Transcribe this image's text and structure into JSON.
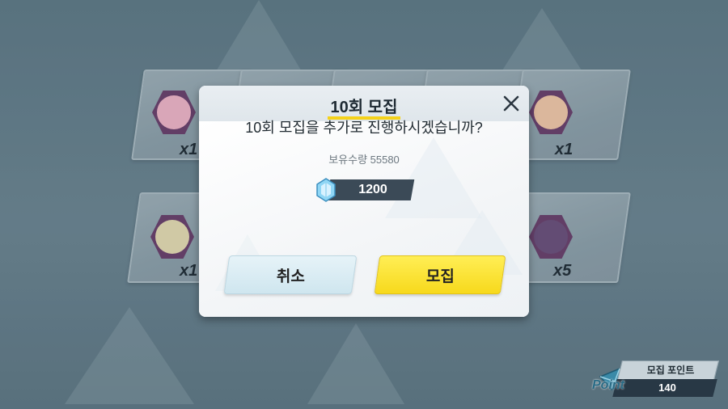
{
  "dialog": {
    "title": "10회 모집",
    "question": "10회 모집을 추가로 진행하시겠습니까?",
    "owned_label": "보유수량 55580",
    "cost": "1200",
    "cancel_label": "취소",
    "confirm_label": "모집"
  },
  "results": [
    {
      "count": "x1",
      "color": "#f2b6c8"
    },
    {
      "count": "x1",
      "color": "#f4c9a8"
    },
    {
      "count": "x1",
      "color": "#e8ddb2"
    },
    {
      "count": "x5",
      "color": "#6b4f7a"
    }
  ],
  "point_panel": {
    "label": "모집 포인트",
    "value": "140",
    "icon_text": "Point"
  },
  "colors": {
    "accent_yellow": "#f5d21a",
    "confirm_button": "#f7d91c",
    "cancel_button": "#d6ebf3",
    "cost_bar": "#3b4a57"
  }
}
